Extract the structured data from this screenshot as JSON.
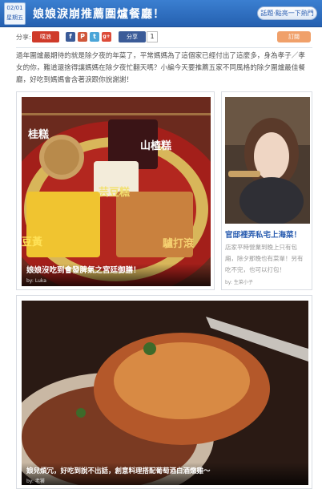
{
  "header": {
    "date_md": "02/01",
    "date_wd": "星期五",
    "title": "娘娘淚崩推薦圍爐餐廳！",
    "vote_button": "話題‧點亮一下熱門"
  },
  "share": {
    "label": "分享:",
    "plurk": "噗浪",
    "icons": [
      "f",
      "P",
      "t",
      "g+"
    ],
    "fb_share": "分享",
    "fb_count": "1",
    "rss": "訂閱"
  },
  "intro": "過年圍爐最期待的就是除夕夜的年菜了，平常媽媽為了這個家已經付出了這麼多，身為孝子／孝女的你，難道還捨得讓媽媽在除夕夜忙翻天嗎？小編今天要推薦五家不同風格的除夕圍爐最佳餐廳，好吃到媽媽會含著淚跟你說謝謝！",
  "cards": [
    {
      "caption": "娘娘沒吃到會發脾氣之宮廷御膳！",
      "by": "by: Luka",
      "food_labels": [
        "桂糕",
        "山楂糕",
        "芸豆糕",
        "豆黃",
        "驢打滾"
      ]
    },
    {
      "title": "官邸裡弄私宅上海菜！",
      "text": "店家平時營業到晚上只有包廂，除夕那晚也有菜單！另有吃不完，也可以打包！",
      "by": "by: 生菜小子"
    },
    {
      "caption": "娘兒煩冗，好吃到說不出話，創意料理搭配葡萄酒白酒燉雞～",
      "by": "by: 老饕"
    }
  ]
}
